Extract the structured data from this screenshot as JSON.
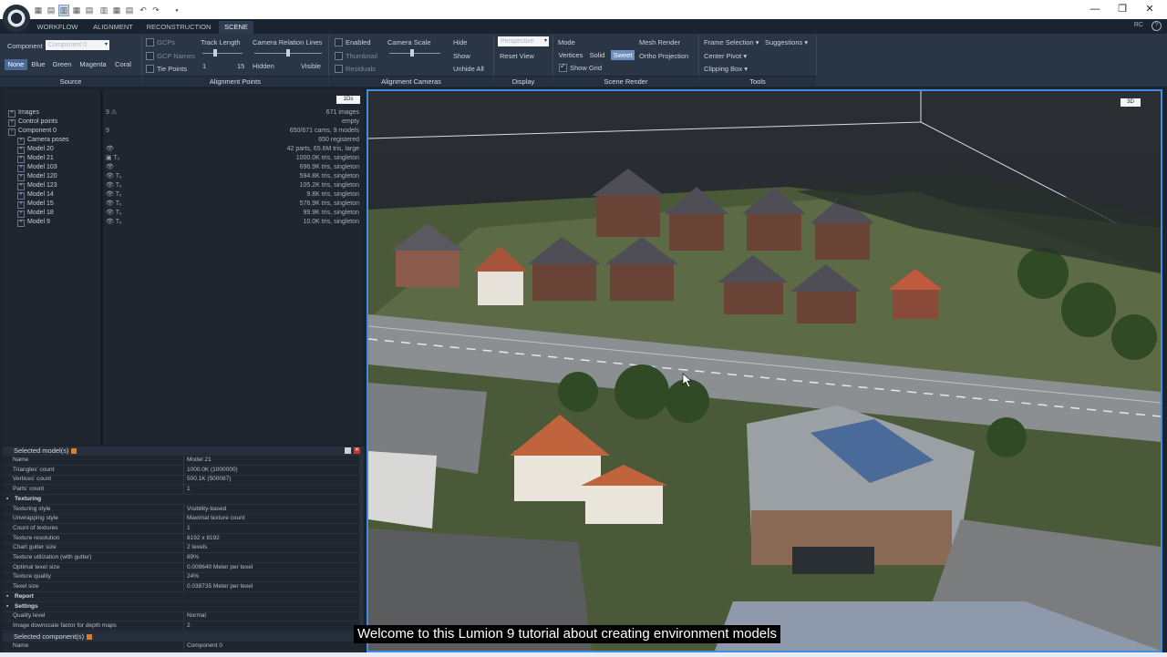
{
  "quick_access": [
    "▦",
    "▤",
    "▥",
    "▦",
    "▤",
    "▥",
    "▦",
    "▤",
    "↶",
    "↷",
    "▪"
  ],
  "ribbon_tabs": [
    "WORKFLOW",
    "ALIGNMENT",
    "RECONSTRUCTION",
    "SCENE"
  ],
  "right_label": "RC",
  "help": "?",
  "window": {
    "minimize": "—",
    "restore": "❐",
    "close": "✕"
  },
  "source": {
    "component_label": "Component",
    "component_value": "Component 0",
    "colors": [
      "None",
      "Blue",
      "Green",
      "Magenta",
      "Coral"
    ],
    "title": "Source"
  },
  "alignment_points": {
    "gcps": "GCPs",
    "gcp_names": "GCP Names",
    "tie_points": "Tie Points",
    "track_length": "Track Length",
    "track_min": "1",
    "track_max": "15",
    "camera_relation_lines": "Camera Relation Lines",
    "hidden": "Hidden",
    "visible": "Visible",
    "title": "Alignment Points"
  },
  "alignment_cameras": {
    "enabled": "Enabled",
    "thumbnail": "Thumbnail",
    "residuals": "Residuals",
    "camera_scale": "Camera Scale",
    "hide": "Hide",
    "show": "Show",
    "unhide_all": "Unhide All",
    "title": "Alignment Cameras"
  },
  "display": {
    "projection": "Perspective",
    "reset_view": "Reset View",
    "title": "Display"
  },
  "scene_render": {
    "mode": "Mode",
    "vertices": "Vertices",
    "solid": "Solid",
    "sweet": "Sweet",
    "show_grid": "Show Grid",
    "mesh_render": "Mesh Render",
    "ortho_projection": "Ortho Projection",
    "title": "Scene Render"
  },
  "tools": {
    "frame_selection": "Frame Selection",
    "suggestions": "Suggestions",
    "center_pivot": "Center Pivot",
    "clipping_box": "Clipping Box",
    "title": "Tools"
  },
  "tree": {
    "badge": "1Ds",
    "rows": [
      {
        "name": "Images",
        "icon": "9 ⚠",
        "value": "671 images",
        "depth": 0,
        "exp": "+"
      },
      {
        "name": "Control points",
        "icon": "",
        "value": "empty",
        "depth": 0,
        "exp": "+"
      },
      {
        "name": "Component 0",
        "icon": "9",
        "value": "650/671 cams, 9 models",
        "depth": 0,
        "exp": "−"
      },
      {
        "name": "Camera poses",
        "icon": "",
        "value": "650 registered",
        "depth": 1,
        "exp": "+"
      },
      {
        "name": "Model 20",
        "icon": "👁",
        "value": "42 parts, 65.6M tris, large",
        "depth": 1,
        "exp": "+"
      },
      {
        "name": "Model 21",
        "icon": "▣ Tₓ",
        "value": "1000.0K tris, singleton",
        "depth": 1,
        "exp": "+"
      },
      {
        "name": "Model 103",
        "icon": "👁",
        "value": "696.9K tris, singleton",
        "depth": 1,
        "exp": "+"
      },
      {
        "name": "Model 120",
        "icon": "👁 Tₓ",
        "value": "594.8K tris, singleton",
        "depth": 1,
        "exp": "+"
      },
      {
        "name": "Model 123",
        "icon": "👁 Tₓ",
        "value": "105.2K tris, singleton",
        "depth": 1,
        "exp": "+"
      },
      {
        "name": "Model 14",
        "icon": "👁 Tₓ",
        "value": "9.8K tris, singleton",
        "depth": 1,
        "exp": "+"
      },
      {
        "name": "Model 15",
        "icon": "👁 Tₓ",
        "value": "576.9K tris, singleton",
        "depth": 1,
        "exp": "+"
      },
      {
        "name": "Model 18",
        "icon": "👁 Tₓ",
        "value": "99.9K tris, singleton",
        "depth": 1,
        "exp": "+"
      },
      {
        "name": "Model 9",
        "icon": "👁 Tₓ",
        "value": "10.0K tris, singleton",
        "depth": 1,
        "exp": "+"
      }
    ]
  },
  "selected_models": {
    "header": "Selected model(s)",
    "close": "✕",
    "rows": [
      {
        "k": "Name",
        "v": "Model 21",
        "group": false
      },
      {
        "k": "Triangles' count",
        "v": "1000.0K (1000000)",
        "group": false
      },
      {
        "k": "Vertices' count",
        "v": "500.1K (500087)",
        "group": false
      },
      {
        "k": "Parts' count",
        "v": "1",
        "group": false
      },
      {
        "k": "Texturing",
        "v": "",
        "group": true
      },
      {
        "k": "Texturing style",
        "v": "Visibility-based",
        "group": false
      },
      {
        "k": "Unwrapping style",
        "v": "Maximal texture count",
        "group": false
      },
      {
        "k": "Count of textures",
        "v": "1",
        "group": false
      },
      {
        "k": "Texture resolution",
        "v": "8192 x 8192",
        "group": false
      },
      {
        "k": "Chart gutter size",
        "v": "2 texels",
        "group": false
      },
      {
        "k": "Texture utilization (with gutter)",
        "v": "89%",
        "group": false
      },
      {
        "k": "Optimal texel size",
        "v": "0.009640 Meter per texel",
        "group": false
      },
      {
        "k": "Texture quality",
        "v": "24%",
        "group": false
      },
      {
        "k": "Texel size",
        "v": "0.038735 Meter per texel",
        "group": false
      },
      {
        "k": "Report",
        "v": "",
        "group": true
      },
      {
        "k": "Settings",
        "v": "",
        "group": true
      },
      {
        "k": "Quality level",
        "v": "Normal",
        "group": false
      },
      {
        "k": "Image downscale factor for depth maps",
        "v": "2",
        "group": false
      }
    ]
  },
  "selected_components": {
    "header": "Selected component(s)",
    "close": "✕",
    "rows": [
      {
        "k": "Name",
        "v": "Component 0",
        "group": false
      }
    ]
  },
  "view3d": {
    "badge": "3D",
    "caption": "Welcome to this Lumion 9 tutorial about creating environment models"
  }
}
